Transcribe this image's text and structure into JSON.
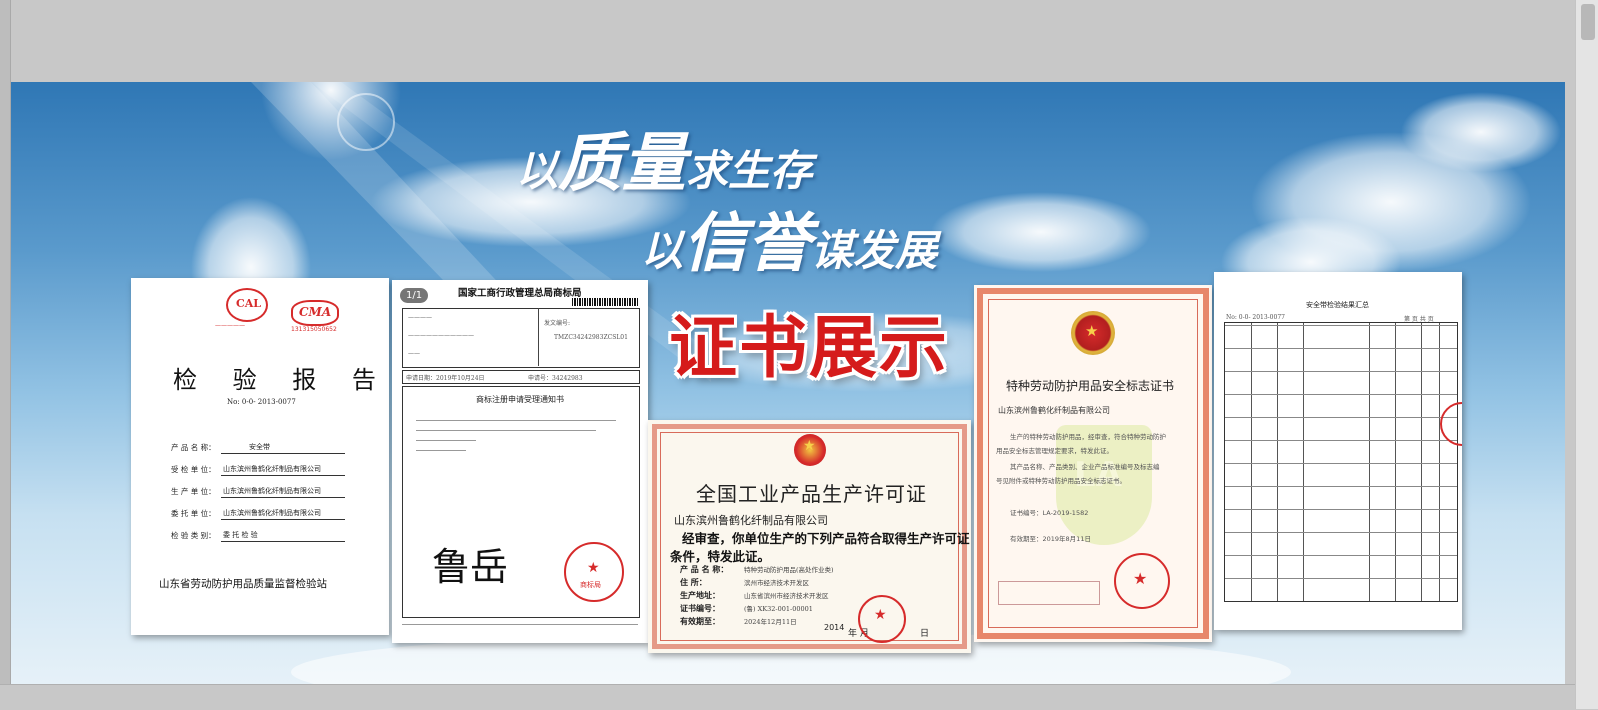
{
  "slogans": {
    "line1": {
      "pre": "以",
      "big": "质量",
      "post": "求生存"
    },
    "line2": {
      "pre": "以",
      "big": "信誉",
      "post": "谋发展"
    }
  },
  "section_title": "证书展示",
  "report": {
    "title": "检 验 报 告",
    "number": "No: 0-0- 2013-0077",
    "stamp_left": "CAL",
    "stamp_right": "CMA",
    "stamp_right_code": "131315050652",
    "rows": [
      {
        "label": "产 品 名 称：",
        "value": "安全带"
      },
      {
        "label": "受 检 单 位：",
        "value": "山东滨州鲁鹤化纤制品有限公司"
      },
      {
        "label": "生 产 单 位：",
        "value": "山东滨州鲁鹤化纤制品有限公司"
      },
      {
        "label": "委 托 单 位：",
        "value": "山东滨州鲁鹤化纤制品有限公司"
      },
      {
        "label": "检 验 类 别：",
        "value": "委 托 检 验"
      }
    ],
    "issuer": "山东省劳动防护用品质量监督检验站"
  },
  "trademark": {
    "page_badge": "1/1",
    "agency": "国家工商行政管理总局商标局",
    "notice_title": "商标注册申请受理通知书",
    "field_serial": "发文编号:",
    "serial_value": "TMZC34242983ZCSL01",
    "apply_date_label": "申请日期：2019年10月24日",
    "apply_no_label": "申请号：34242983",
    "signature": "鲁岳",
    "stamp_text": "商标局"
  },
  "license": {
    "title": "全国工业产品生产许可证",
    "company": "山东滨州鲁鹤化纤制品有限公司",
    "statement_1": "经审查，你单位生产的下列产品符合取得生产许可证",
    "statement_2": "条件，特发此证。",
    "rows": [
      {
        "label": "产 品 名 称：",
        "value": "特种劳动防护用品(高处作业类)"
      },
      {
        "label": "住    所：",
        "value": "滨州市经济技术开发区"
      },
      {
        "label": "生产地址：",
        "value": "山东省滨州市经济技术开发区"
      },
      {
        "label": "证书编号：",
        "value": "(鲁) XK32-001-00001"
      },
      {
        "label": "有效期至：",
        "value": "2024年12月11日"
      }
    ],
    "date_year": "2014",
    "date_month": "年   月",
    "date_day": "日"
  },
  "la_cert": {
    "title": "特种劳动防护用品安全标志证书",
    "company": "山东滨州鲁鹤化纤制品有限公司",
    "body_1": "生产的特种劳动防护用品，经审查，符合特种劳动防护",
    "body_2": "用品安全标志管理规定要求，特发此证。",
    "body_3": "其产品名称、产品类别、企业产品标准编号及标志编",
    "body_4": "号见附件或特种劳动防护用品安全标志证书。",
    "cert_no": "证书编号：LA-2019-1582",
    "valid": "有效期至：2019年8月11日",
    "watermark": "LA"
  },
  "inspection": {
    "title": "安全带检验结果汇总",
    "number": "No: 0-0- 2013-0077",
    "page": "第 页 共 页",
    "rows": 12
  },
  "colors": {
    "stamp_red": "#d62b2b",
    "title_red": "#d51b1b",
    "sky_top": "#2f77b5",
    "sky_bottom": "#e6f1f8"
  }
}
